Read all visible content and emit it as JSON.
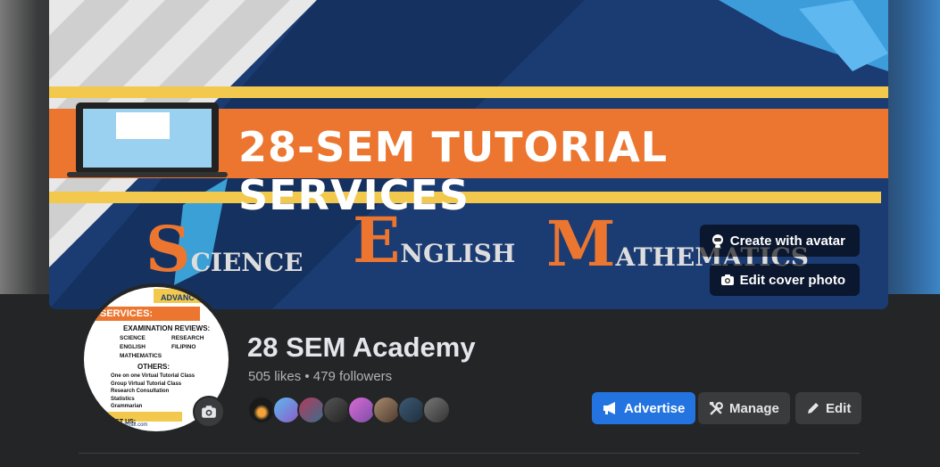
{
  "cover": {
    "banner_title": "28-SEM TUTORIAL SERVICES",
    "subjects": [
      {
        "initial": "S",
        "rest": "CIENCE"
      },
      {
        "initial": "E",
        "rest": "NGLISH"
      },
      {
        "initial": "M",
        "rest": "ATHEMATICS"
      }
    ],
    "create_avatar_label": "Create with avatar",
    "edit_cover_label": "Edit cover photo"
  },
  "profile_image": {
    "advanced_label": "ADVANC",
    "services_label": "SERVICES:",
    "exam_label": "EXAMINATION REVIEWS:",
    "subjects_left": [
      "SCIENCE",
      "ENGLISH",
      "MATHEMATICS"
    ],
    "subjects_right": [
      "RESEARCH",
      "FILIPINO"
    ],
    "others_label": "OTHERS:",
    "others_items": [
      "One on one Virtual Tutorial Class",
      "Group Virtual Tutorial Class",
      "Research Consultation",
      "Statistics",
      "Grammarian"
    ],
    "contact_label": "TACT US:",
    "email_fragment": "my@gmail.com"
  },
  "page": {
    "name": "28 SEM Academy",
    "stats": "505 likes • 479 followers"
  },
  "actions": {
    "advertise": "Advertise",
    "manage": "Manage",
    "edit": "Edit"
  },
  "colors": {
    "accent": "#2374e1",
    "banner_orange": "#ec7630",
    "banner_yellow": "#f2c94c",
    "cover_navy": "#1b3b73"
  }
}
